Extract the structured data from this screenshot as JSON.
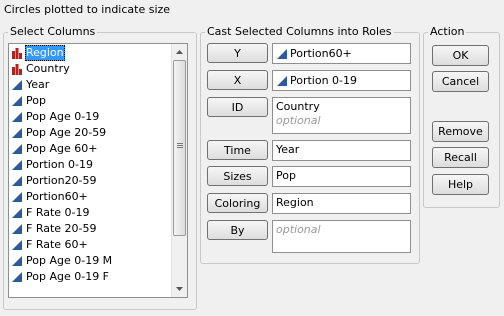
{
  "dialog_title": "Circles plotted to indicate size",
  "select_columns": {
    "title": "Select Columns",
    "items": [
      {
        "label": "Region",
        "icon": "nominal-bar-icon",
        "selected": true
      },
      {
        "label": "Country",
        "icon": "nominal-bar-icon",
        "selected": false
      },
      {
        "label": "Year",
        "icon": "continuous-triangle-icon",
        "selected": false
      },
      {
        "label": "Pop",
        "icon": "continuous-triangle-icon",
        "selected": false
      },
      {
        "label": "Pop Age 0-19",
        "icon": "continuous-triangle-icon",
        "selected": false
      },
      {
        "label": "Pop Age 20-59",
        "icon": "continuous-triangle-icon",
        "selected": false
      },
      {
        "label": "Pop Age 60+",
        "icon": "continuous-triangle-icon",
        "selected": false
      },
      {
        "label": "Portion 0-19",
        "icon": "continuous-triangle-icon",
        "selected": false
      },
      {
        "label": "Portion20-59",
        "icon": "continuous-triangle-icon",
        "selected": false
      },
      {
        "label": "Portion60+",
        "icon": "continuous-triangle-icon",
        "selected": false
      },
      {
        "label": "F Rate 0-19",
        "icon": "continuous-triangle-icon",
        "selected": false
      },
      {
        "label": "F Rate 20-59",
        "icon": "continuous-triangle-icon",
        "selected": false
      },
      {
        "label": "F Rate 60+",
        "icon": "continuous-triangle-icon",
        "selected": false
      },
      {
        "label": "Pop Age 0-19 M",
        "icon": "continuous-triangle-icon",
        "selected": false
      },
      {
        "label": "Pop Age 0-19 F",
        "icon": "continuous-triangle-icon",
        "selected": false
      }
    ]
  },
  "cast_roles": {
    "title": "Cast Selected Columns into Roles",
    "roles": [
      {
        "name": "y",
        "button": "Y",
        "values": [
          "Portion60+"
        ],
        "icon": "continuous-triangle-icon"
      },
      {
        "name": "x",
        "button": "X",
        "values": [
          "Portion 0-19"
        ],
        "icon": "continuous-triangle-icon"
      },
      {
        "name": "id",
        "button": "ID",
        "values": [
          "Country"
        ],
        "optional": "optional"
      },
      {
        "name": "time",
        "button": "Time",
        "values": [
          "Year"
        ]
      },
      {
        "name": "sizes",
        "button": "Sizes",
        "values": [
          "Pop"
        ]
      },
      {
        "name": "coloring",
        "button": "Coloring",
        "values": [
          "Region"
        ]
      },
      {
        "name": "by",
        "button": "By",
        "values": [],
        "optional": "optional"
      }
    ]
  },
  "action": {
    "title": "Action",
    "ok": "OK",
    "cancel": "Cancel",
    "remove": "Remove",
    "recall": "Recall",
    "help": "Help"
  },
  "colors": {
    "nominal_icon": "#b22222",
    "continuous_icon": "#2c5aa0",
    "selection": "#3399ff"
  }
}
